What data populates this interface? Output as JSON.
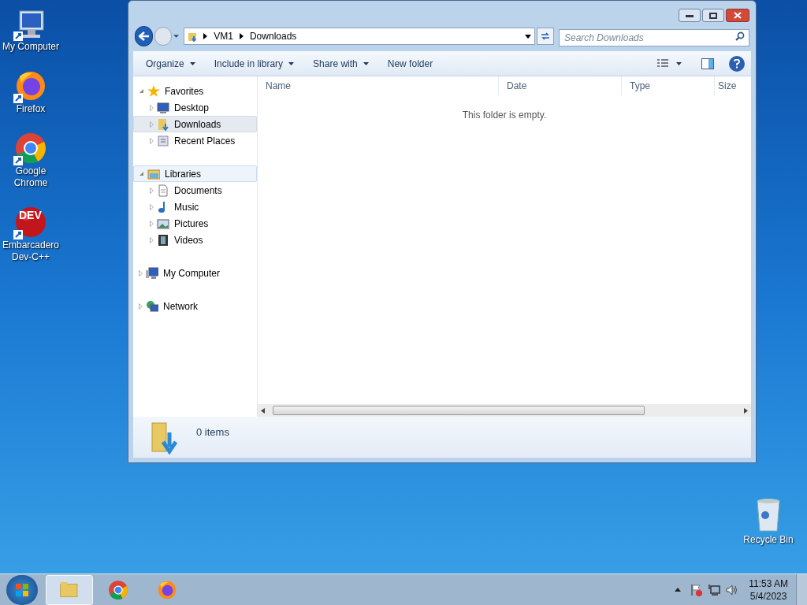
{
  "desktop_icons": [
    {
      "kind": "computer",
      "label": "My Computer"
    },
    {
      "kind": "firefox",
      "label": "Firefox"
    },
    {
      "kind": "chrome",
      "label": "Google Chrome"
    },
    {
      "kind": "devcpp",
      "label": "Embarcadero Dev-C++",
      "logo_text": "DEV"
    }
  ],
  "recycle_bin": {
    "label": "Recycle Bin"
  },
  "window": {
    "breadcrumb": [
      "VM1",
      "Downloads"
    ],
    "search": {
      "placeholder": "Search Downloads"
    },
    "toolbar": [
      {
        "label": "Organize",
        "dropdown": true
      },
      {
        "label": "Include in library",
        "dropdown": true
      },
      {
        "label": "Share with",
        "dropdown": true
      },
      {
        "label": "New folder",
        "dropdown": false
      }
    ],
    "nav_pane": [
      {
        "label": "Favorites",
        "kind": "favorites",
        "expanded": true,
        "selected": false,
        "hovered": false,
        "children": [
          {
            "label": "Desktop",
            "kind": "desktop",
            "selected": false
          },
          {
            "label": "Downloads",
            "kind": "downloads",
            "selected": true
          },
          {
            "label": "Recent Places",
            "kind": "recent",
            "selected": false
          }
        ]
      },
      {
        "label": "Libraries",
        "kind": "libraries",
        "expanded": true,
        "selected": false,
        "hovered": true,
        "children": [
          {
            "label": "Documents",
            "kind": "documents",
            "selected": false
          },
          {
            "label": "Music",
            "kind": "music",
            "selected": false
          },
          {
            "label": "Pictures",
            "kind": "pictures",
            "selected": false
          },
          {
            "label": "Videos",
            "kind": "videos",
            "selected": false
          }
        ]
      },
      {
        "label": "My Computer",
        "kind": "computer",
        "expanded": false,
        "selected": false,
        "hovered": false
      },
      {
        "label": "Network",
        "kind": "network",
        "expanded": false,
        "selected": false,
        "hovered": false
      }
    ],
    "columns": [
      "Name",
      "Date",
      "Type",
      "Size"
    ],
    "empty_message": "This folder is empty.",
    "status": "0 items"
  },
  "taskbar": {
    "apps": [
      {
        "kind": "explorer",
        "selected": true
      },
      {
        "kind": "chrome",
        "selected": false
      },
      {
        "kind": "firefox",
        "selected": false
      }
    ],
    "time": "11:53 AM",
    "date": "5/4/2023"
  }
}
